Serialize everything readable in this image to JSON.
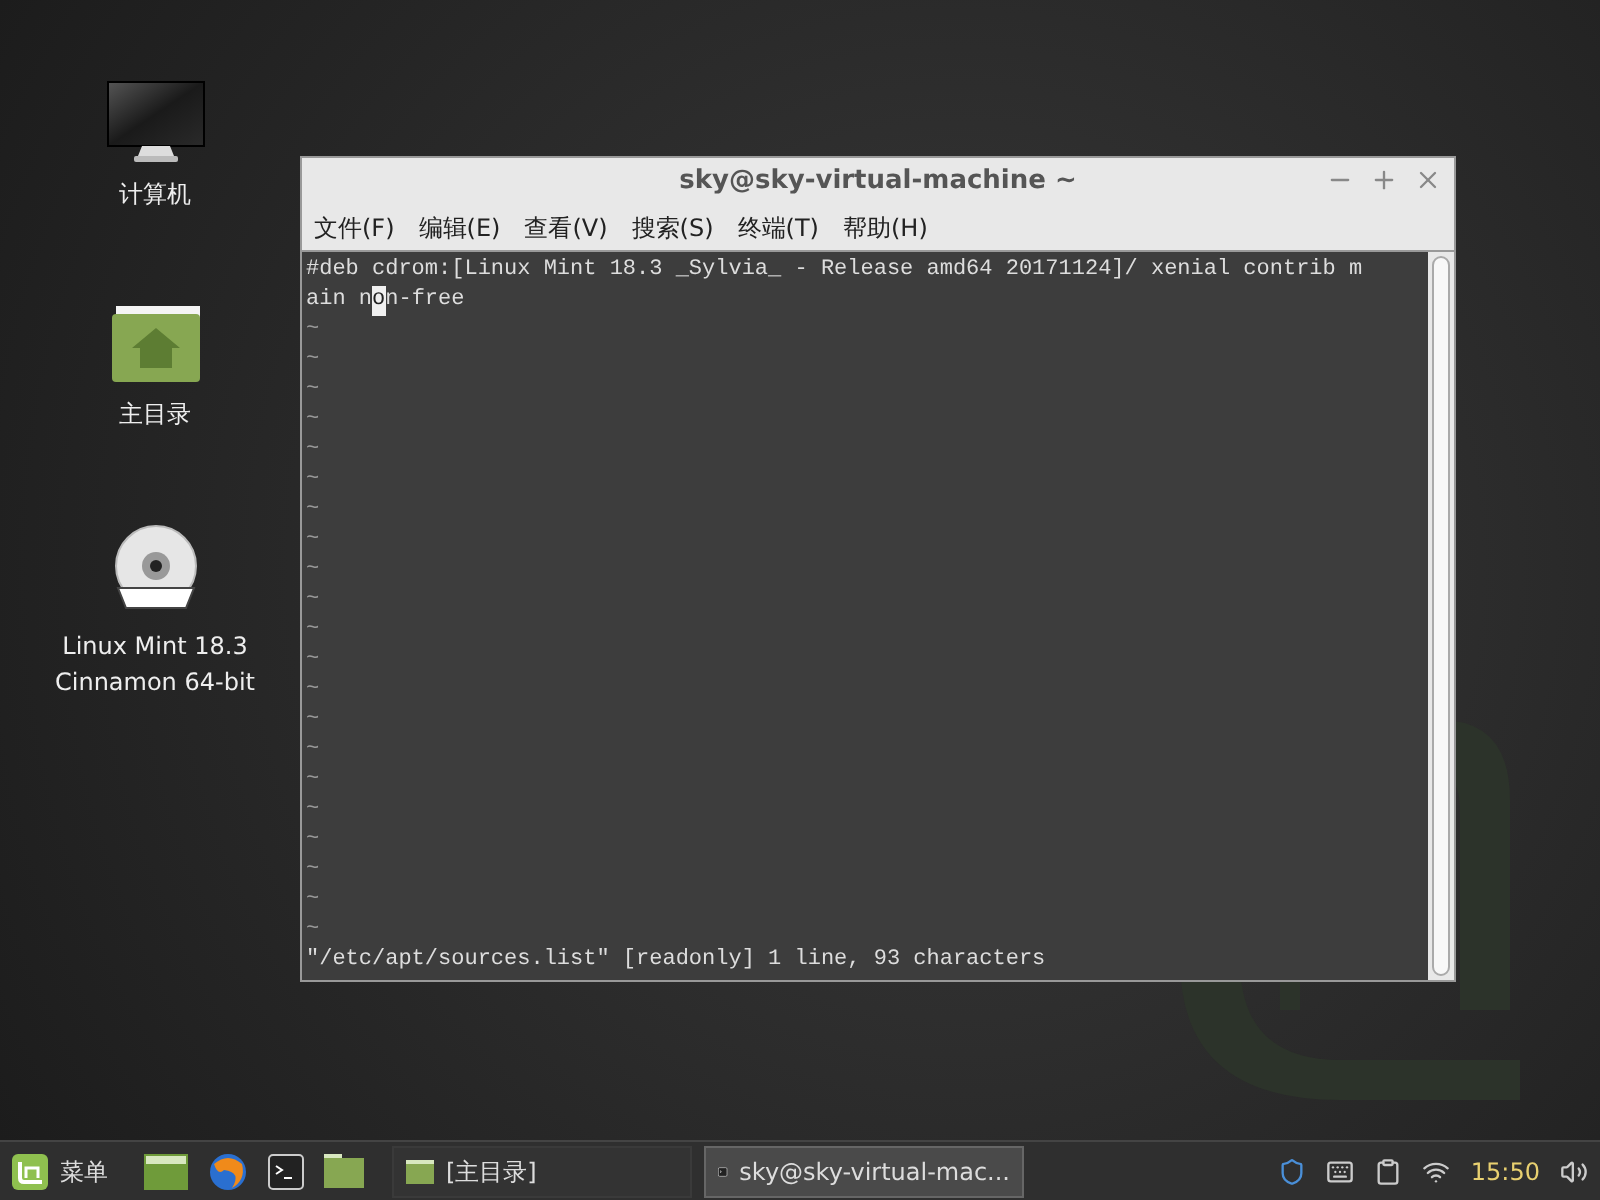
{
  "desktop_icons": [
    {
      "kind": "monitor",
      "label": "计算机"
    },
    {
      "kind": "home-folder",
      "label": "主目录"
    },
    {
      "kind": "dvd",
      "label": "Linux Mint 18.3 Cinnamon 64-bit"
    }
  ],
  "window": {
    "title": "sky@sky-virtual-machine ~",
    "menu": [
      "文件(F)",
      "编辑(E)",
      "查看(V)",
      "搜索(S)",
      "终端(T)",
      "帮助(H)"
    ],
    "buffer": {
      "first_line": "#deb cdrom:[Linux Mint 18.3 _Sylvia_ - Release amd64 20171124]/ xenial contrib m",
      "cursor_line": {
        "before": "ain n",
        "cursor_char": "o",
        "after": "n-free"
      }
    },
    "tildes": [
      "~",
      "~",
      "~",
      "~",
      "~",
      "~",
      "~",
      "~",
      "~",
      "~",
      "~",
      "~",
      "~",
      "~",
      "~",
      "~",
      "~",
      "~",
      "~",
      "~",
      "~"
    ],
    "status_line": "\"/etc/apt/sources.list\" [readonly] 1 line, 93 characters"
  },
  "taskbar": {
    "menu_label": "菜单",
    "launchers": [
      {
        "kind": "desktop"
      },
      {
        "kind": "browser"
      },
      {
        "kind": "terminal"
      },
      {
        "kind": "folder"
      }
    ],
    "windows": [
      {
        "kind": "folder",
        "label": "[主目录]",
        "selected": false
      },
      {
        "kind": "terminal",
        "label": "sky@sky-virtual-mac...",
        "selected": true
      }
    ],
    "clock": "15:50"
  }
}
